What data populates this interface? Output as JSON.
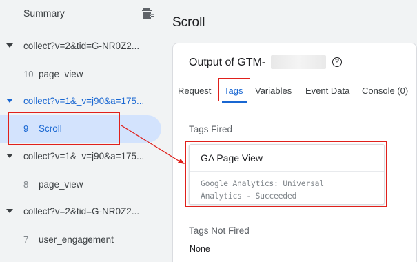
{
  "sidebar": {
    "summary_label": "Summary",
    "groups": [
      {
        "label": "collect?v=2&tid=G-NR0Z2...",
        "event_num": "10",
        "event_name": "page_view"
      },
      {
        "label": "collect?v=1&_v=j90&a=175...",
        "event_num": "9",
        "event_name": "Scroll"
      },
      {
        "label": "collect?v=1&_v=j90&a=175...",
        "event_num": "8",
        "event_name": "page_view"
      },
      {
        "label": "collect?v=2&tid=G-NR0Z2...",
        "event_num": "7",
        "event_name": "user_engagement"
      }
    ]
  },
  "main": {
    "title": "Scroll",
    "card_heading": "Output of GTM-",
    "tabs": [
      "Request",
      "Tags",
      "Variables",
      "Event Data",
      "Console (0)"
    ],
    "tags_fired_label": "Tags Fired",
    "tag": {
      "name": "GA Page View",
      "description": "Google Analytics: Universal Analytics - Succeeded"
    },
    "tags_not_fired_label": "Tags Not Fired",
    "not_fired_value": "None"
  },
  "colors": {
    "accent": "#1967d2",
    "selected_bg": "#d3e3fd",
    "annotation": "#e0201b"
  },
  "icons": [
    "trash-icon",
    "caret-down-icon",
    "help-icon"
  ]
}
